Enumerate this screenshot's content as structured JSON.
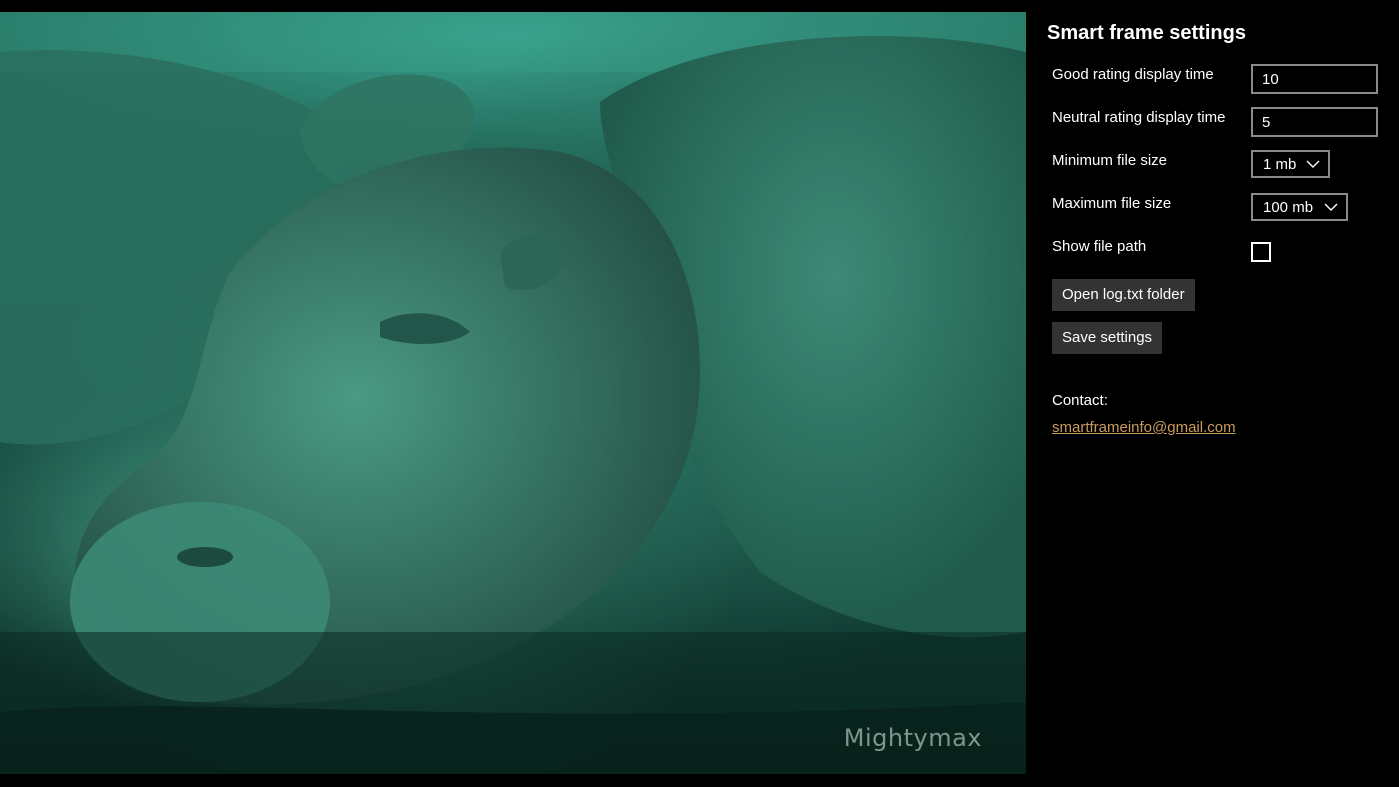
{
  "photo": {
    "watermark": "Mightymax",
    "subject": "underwater-hippo-photo"
  },
  "settings": {
    "title": "Smart frame settings",
    "good_rating": {
      "label": "Good rating display time",
      "value": "10"
    },
    "neutral_rating": {
      "label": "Neutral rating display time",
      "value": "5"
    },
    "min_file_size": {
      "label": "Minimum file size",
      "selected": "1 mb"
    },
    "max_file_size": {
      "label": "Maximum file size",
      "selected": "100 mb"
    },
    "show_file_path": {
      "label": "Show file path",
      "checked": false
    },
    "open_log_button": "Open log.txt folder",
    "save_button": "Save settings",
    "contact": {
      "label": "Contact:",
      "email": "smartframeinfo@gmail.com"
    }
  },
  "colors": {
    "background": "#000000",
    "button_bg": "#333333",
    "input_border": "#8a8a8a",
    "link": "#c89a5e"
  },
  "icons": {
    "dropdown": "chevron-down-icon"
  }
}
